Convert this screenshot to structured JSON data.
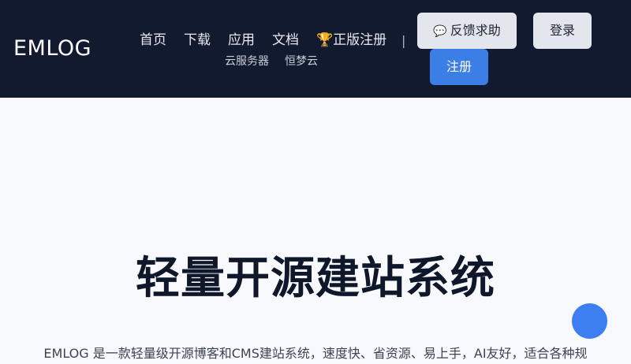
{
  "header": {
    "logo": "EMLOG",
    "nav": [
      {
        "label": "首页"
      },
      {
        "label": "下载"
      },
      {
        "label": "应用"
      },
      {
        "label": "文档"
      },
      {
        "label": "🏆正版注册"
      }
    ],
    "sub_nav": [
      {
        "label": "云服务器"
      },
      {
        "label": "恒梦云"
      }
    ],
    "separator": "|",
    "feedback_label": "反馈求助",
    "feedback_icon": "💬",
    "login_label": "登录",
    "register_label": "注册"
  },
  "hero": {
    "title": "轻量开源建站系统",
    "description": "EMLOG 是一款轻量级开源博客和CMS建站系统，速度快、省资源、易上手，AI友好，适合各种规"
  },
  "colors": {
    "header_bg": "#111a2e",
    "primary": "#3b7ee6",
    "page_bg": "#f7f9fc"
  }
}
